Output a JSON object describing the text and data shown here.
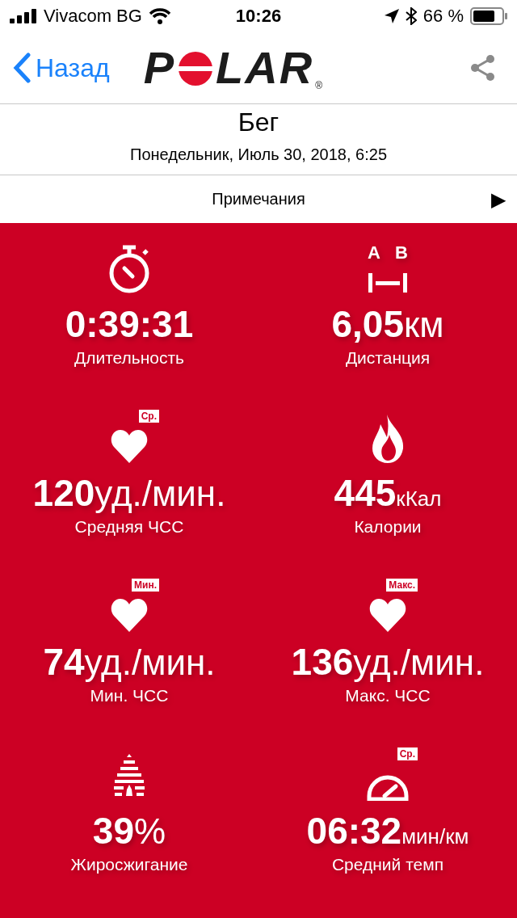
{
  "status_bar": {
    "carrier": "Vivacom BG",
    "time": "10:26",
    "battery": "66 %"
  },
  "nav": {
    "back": "Назад",
    "logo": {
      "before": "P",
      "after": "LAR",
      "mark": "®"
    }
  },
  "header": {
    "title": "Бег",
    "date": "Понедельник, Июль 30, 2018, 6:25"
  },
  "notes": {
    "label": "Примечания",
    "arrow": "▶"
  },
  "distance_icon_letters": [
    "A",
    "B"
  ],
  "icon_badges": [
    "Ср.",
    "Мин.",
    "Макс.",
    "Ср."
  ],
  "stats": [
    {
      "kind": "stopwatch",
      "value": "0:39:31",
      "label": "Длительность"
    },
    {
      "kind": "distance",
      "value": "6,05",
      "unit": "км",
      "label": "Дистанция"
    },
    {
      "kind": "heart",
      "badged": true,
      "value": "120",
      "unit": "уд./мин.",
      "label": "Средняя ЧСС"
    },
    {
      "kind": "flame",
      "value": "445",
      "unit": "кКал",
      "label": "Калории"
    },
    {
      "kind": "heart",
      "badged": true,
      "value": "74",
      "unit": "уд./мин.",
      "label": "Мин. ЧСС"
    },
    {
      "kind": "heart",
      "badged": true,
      "value": "136",
      "unit": "уд./мин.",
      "label": "Макс. ЧСС"
    },
    {
      "kind": "fat",
      "value": "39",
      "unit": "%",
      "label": "Жиросжигание"
    },
    {
      "kind": "gauge",
      "badged": true,
      "value": "06:32",
      "unit": "мин/км",
      "label": "Средний темп"
    }
  ]
}
